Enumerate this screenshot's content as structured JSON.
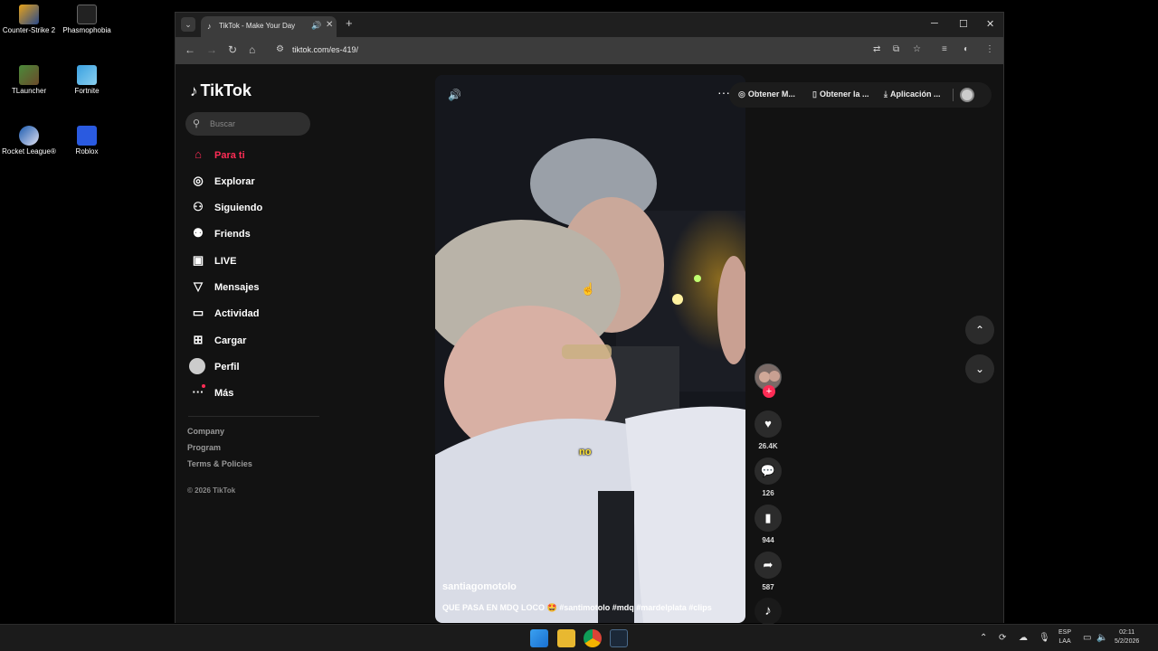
{
  "desktop": {
    "icons": [
      {
        "label": "Counter-Strike 2",
        "icon": "cs2-icon"
      },
      {
        "label": "Phasmophobia",
        "icon": "phasmophobia-icon"
      },
      {
        "label": "TLauncher",
        "icon": "tlauncher-icon"
      },
      {
        "label": "Fortnite",
        "icon": "fortnite-icon"
      },
      {
        "label": "Rocket League®",
        "icon": "rocket-league-icon"
      },
      {
        "label": "Roblox",
        "icon": "roblox-icon"
      }
    ]
  },
  "browser": {
    "tab_title": "TikTok - Make Your Day",
    "url": "tiktok.com/es-419/",
    "new_tab_symbol": "+",
    "tab_close_symbol": "✕"
  },
  "sidebar": {
    "logo_text": "TikTok",
    "search_placeholder": "Buscar",
    "nav": [
      {
        "label": "Para ti",
        "icon": "home-icon",
        "active": true
      },
      {
        "label": "Explorar",
        "icon": "compass-icon"
      },
      {
        "label": "Siguiendo",
        "icon": "following-icon"
      },
      {
        "label": "Friends",
        "icon": "friends-icon"
      },
      {
        "label": "LIVE",
        "icon": "live-icon"
      },
      {
        "label": "Mensajes",
        "icon": "messages-icon"
      },
      {
        "label": "Actividad",
        "icon": "activity-icon"
      },
      {
        "label": "Cargar",
        "icon": "upload-icon"
      },
      {
        "label": "Perfil",
        "icon": "profile-avatar"
      },
      {
        "label": "Más",
        "icon": "more-dots-icon"
      }
    ],
    "footer": {
      "links": [
        "Company",
        "Program",
        "Terms & Policies"
      ],
      "copyright": "© 2026 TikTok"
    }
  },
  "header": {
    "items": [
      {
        "label": "Obtener M...",
        "icon": "coin-icon"
      },
      {
        "label": "Obtener la ...",
        "icon": "phone-icon"
      },
      {
        "label": "Aplicación ...",
        "icon": "download-icon"
      }
    ]
  },
  "video": {
    "username": "santiagomotolo",
    "description": "QUE PASA EN MDQ LOCO 🤩 #santimotolo #mdq #mardelplata #clips",
    "caption_word": "no"
  },
  "actions": {
    "likes": "26.4K",
    "comments": "126",
    "bookmarks": "944",
    "shares": "587"
  },
  "taskbar": {
    "lang_line1": "ESP",
    "lang_line2": "LAA",
    "time": "02:11",
    "date": "5/2/2026"
  },
  "colors": {
    "accent": "#fe2c55",
    "background": "#121212",
    "caption_yellow": "#ffe433"
  }
}
